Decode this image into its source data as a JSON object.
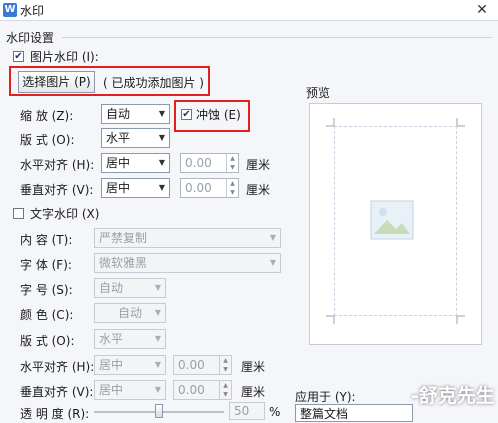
{
  "window": {
    "title": "水印",
    "icon_glyph": "W",
    "close_glyph": "✕"
  },
  "section_title": "水印设置",
  "picture_watermark": {
    "checkbox_label": "图片水印 (I):",
    "checked": true,
    "choose_button": "选择图片 (P)",
    "status": "( 已成功添加图片 )",
    "scale_label": "缩    放 (Z):",
    "scale_value": "自动",
    "washout_label": "冲蚀 (E)",
    "washout_checked": true,
    "layout_label": "版    式 (O):",
    "layout_value": "水平",
    "h_align_label": "水平对齐 (H):",
    "h_align_value": "居中",
    "h_offset": "0.00",
    "h_unit": "厘米",
    "v_align_label": "垂直对齐 (V):",
    "v_align_value": "居中",
    "v_offset": "0.00",
    "v_unit": "厘米"
  },
  "text_watermark": {
    "checkbox_label": "文字水印 (X)",
    "checked": false,
    "content_label": "内    容 (T):",
    "content_value": "严禁复制",
    "font_label": "字    体 (F):",
    "font_value": "微软雅黑",
    "size_label": "字    号 (S):",
    "size_value": "自动",
    "color_label": "颜    色 (C):",
    "color_value": "自动",
    "layout_label": "版    式 (O):",
    "layout_value": "水平",
    "h_align_label": "水平对齐 (H):",
    "h_align_value": "居中",
    "h_offset": "0.00",
    "h_unit": "厘米",
    "v_align_label": "垂直对齐 (V):",
    "v_align_value": "居中",
    "v_offset": "0.00",
    "v_unit": "厘米",
    "transparency_label": "透 明 度 (R):",
    "transparency_value": "50",
    "transparency_unit": "%",
    "transparency_level": 0.5
  },
  "preview": {
    "label": "预览"
  },
  "apply_to": {
    "label": "应用于 (Y):",
    "value": "整篇文档"
  },
  "watermark_overlay": "-舒克先生",
  "colors": {
    "highlight_red": "#e0211d",
    "accent_blue": "#3b78d8"
  }
}
